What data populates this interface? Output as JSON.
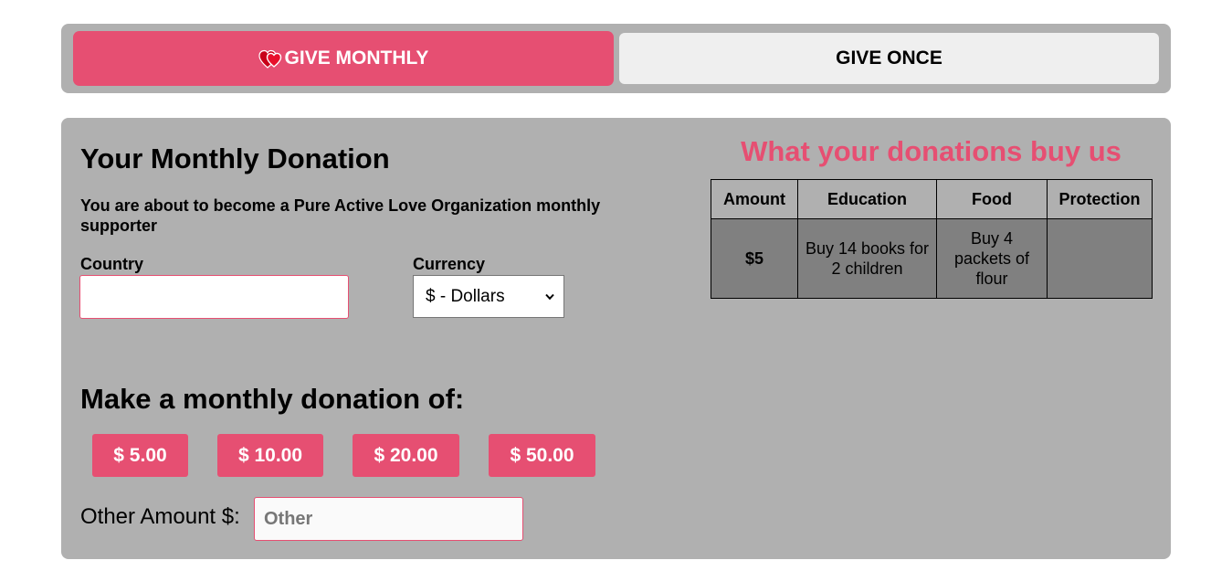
{
  "tabs": {
    "monthly_label": "GIVE MONTHLY",
    "once_label": "GIVE ONCE"
  },
  "form": {
    "title": "Your Monthly Donation",
    "subtitle": "You are about to become a Pure Active Love Organization monthly supporter",
    "country_label": "Country",
    "country_value": "",
    "currency_label": "Currency",
    "currency_selected": "$ - Dollars",
    "donation_heading": "Make a monthly donation of:",
    "amounts": [
      "$ 5.00",
      "$ 10.00",
      "$ 20.00",
      "$ 50.00"
    ],
    "other_label": "Other Amount $:",
    "other_placeholder": "Other"
  },
  "impact": {
    "heading": "What your donations buy us",
    "columns": [
      "Amount",
      "Education",
      "Food",
      "Protection"
    ],
    "rows": [
      [
        "$5",
        "Buy 14 books for 2 children",
        "Buy 4 packets of flour",
        ""
      ]
    ]
  },
  "colors": {
    "accent": "#e64f72",
    "panel": "#b0b0b0",
    "table_cell": "#808080",
    "inactive_tab": "#efefef"
  },
  "icons": {
    "monthly_tab_icon": "two-hearts-icon",
    "currency_dropdown_icon": "chevron-down-icon"
  }
}
